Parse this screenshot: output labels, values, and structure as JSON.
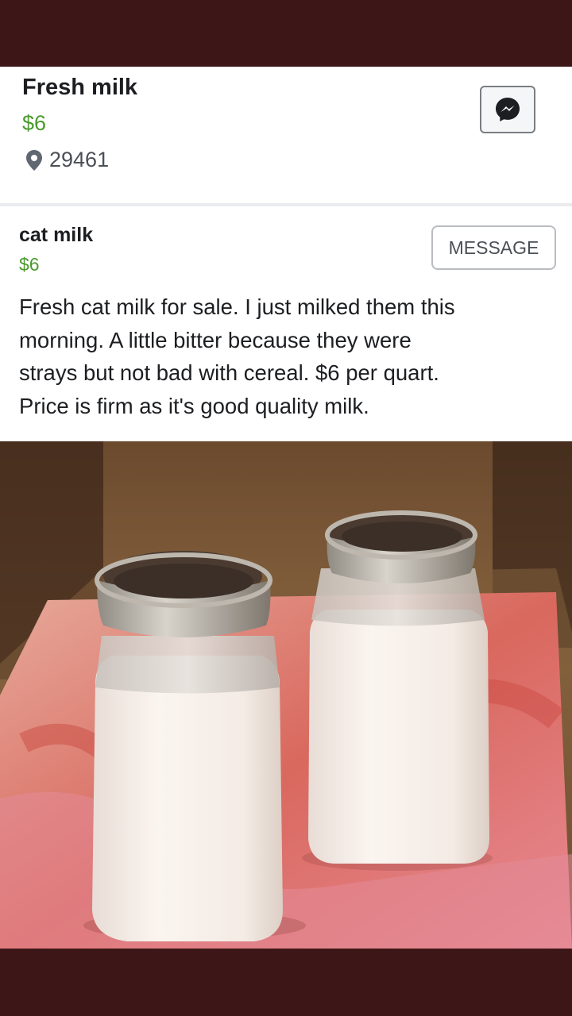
{
  "header": {
    "title": "Fresh milk",
    "price": "$6",
    "location": "29461",
    "location_icon": "map-pin-icon",
    "message_icon": "messenger-icon"
  },
  "listing": {
    "title": "cat milk",
    "price": "$6",
    "message_label": "MESSAGE",
    "description": "Fresh cat milk for sale. I just milked them this\nmorning. A little bitter because they were\nstrays but not bad with cereal. $6 per quart.\nPrice is firm as it's  good quality milk."
  },
  "colors": {
    "price_green": "#4a9a2c",
    "frame": "#3d1717"
  }
}
